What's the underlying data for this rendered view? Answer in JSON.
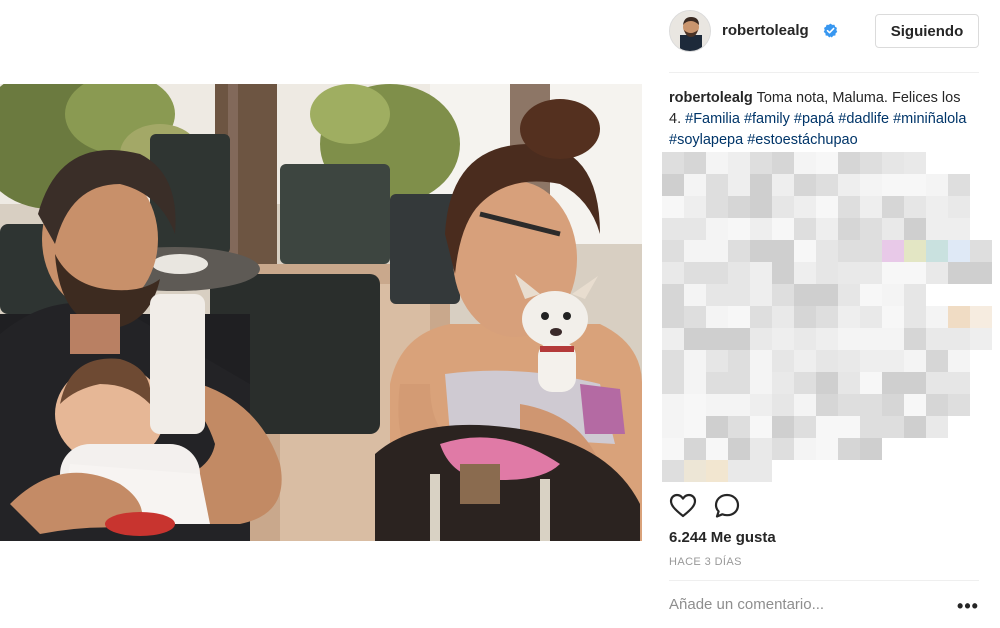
{
  "post": {
    "photo_alt": "Familia en una terraza",
    "username": "robertolealg",
    "verified": true,
    "follow_label": "Siguiendo",
    "caption_user": "robertolealg",
    "caption_text": " Toma nota, Maluma. Felices los 4. ",
    "hashtags": [
      "#Familia",
      "#family",
      "#papá",
      "#dadlife",
      "#miniñalola",
      "#soylapepa",
      "#estoestáchupao"
    ],
    "likes_label": "6.244 Me gusta",
    "time_label": "HACE 3 DÍAS",
    "comment_placeholder": "Añade un comentario...",
    "more_label": "•••"
  },
  "icons": {
    "like": "heart-icon",
    "comment": "comment-icon",
    "verified": "verified-badge-icon",
    "more": "more-options-icon"
  },
  "colors": {
    "text": "#262626",
    "hashtag": "#003569",
    "secondary": "#999999",
    "verified": "#3897f0",
    "border": "#dbdbdb"
  }
}
